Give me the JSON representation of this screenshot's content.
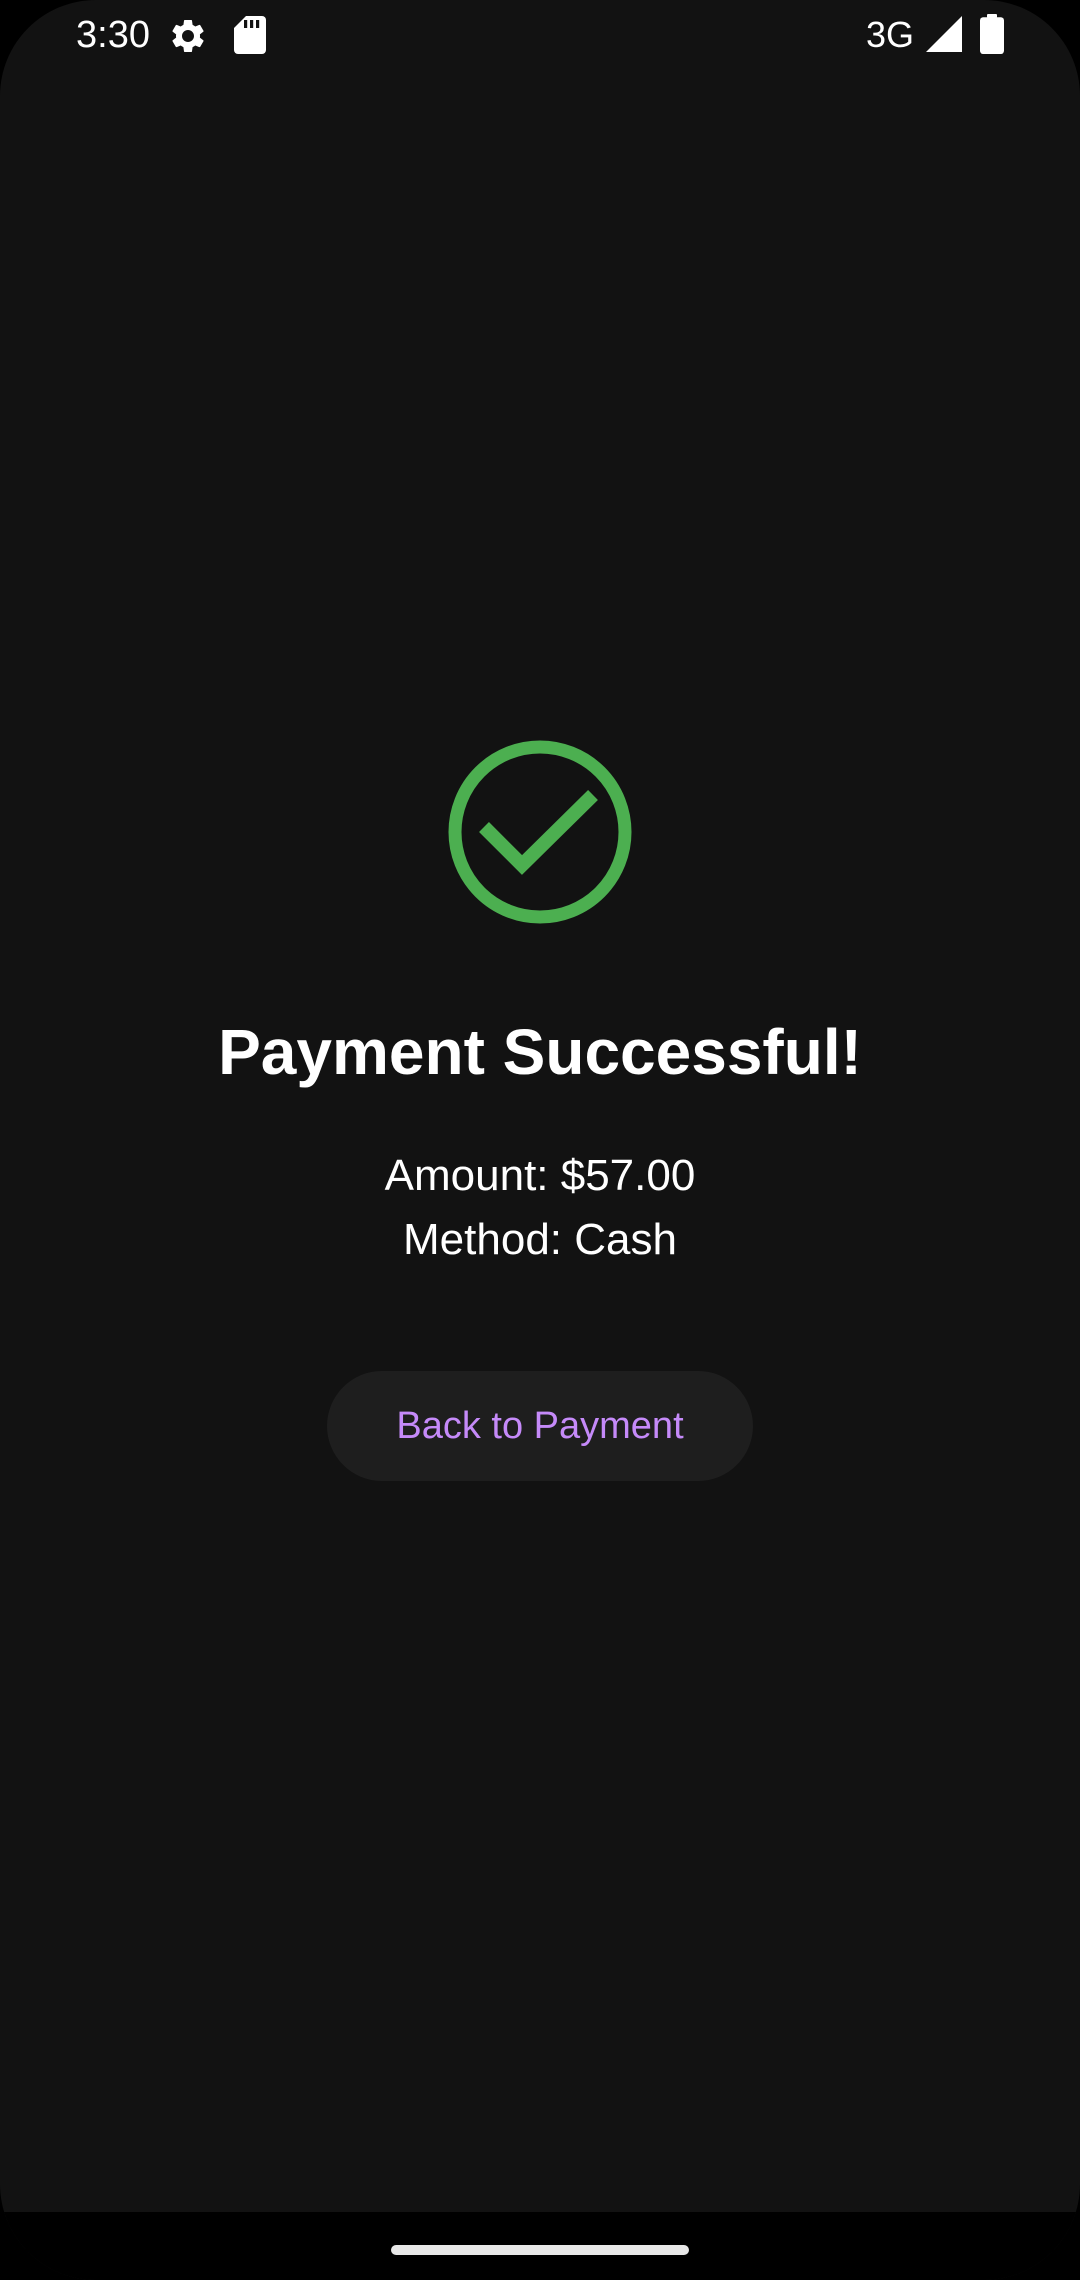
{
  "status_bar": {
    "time": "3:30",
    "network": "3G",
    "icons": [
      "gear-icon",
      "sd-card-icon",
      "signal-icon",
      "battery-icon"
    ]
  },
  "payment_result": {
    "icon": "check-circle-icon",
    "icon_color": "#4caf50",
    "title": "Payment Successful!",
    "amount_text": "Amount: $57.00",
    "method_text": "Method: Cash"
  },
  "actions": {
    "back_label": "Back to Payment",
    "back_color": "#c58af9"
  },
  "theme": {
    "background": "#121212",
    "button_background": "#1e1e1e"
  }
}
